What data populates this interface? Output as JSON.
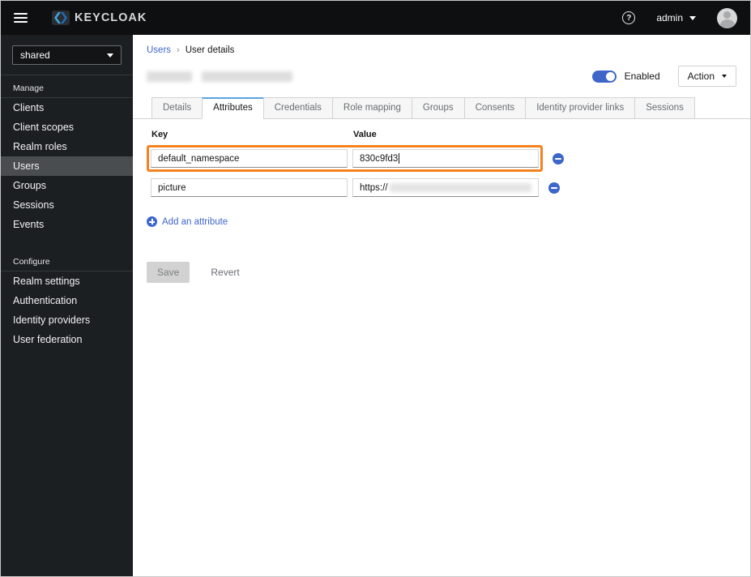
{
  "header": {
    "brand": "KEYCLOAK",
    "help_glyph": "?",
    "username": "admin"
  },
  "sidebar": {
    "realm": "shared",
    "sections": [
      {
        "label": "Manage",
        "items": [
          "Clients",
          "Client scopes",
          "Realm roles",
          "Users",
          "Groups",
          "Sessions",
          "Events"
        ]
      },
      {
        "label": "Configure",
        "items": [
          "Realm settings",
          "Authentication",
          "Identity providers",
          "User federation"
        ]
      }
    ],
    "active_item": "Users"
  },
  "breadcrumb": {
    "parent": "Users",
    "separator": "›",
    "current": "User details"
  },
  "toolbar": {
    "enabled_label": "Enabled",
    "action_label": "Action"
  },
  "tabs": {
    "items": [
      "Details",
      "Attributes",
      "Credentials",
      "Role mapping",
      "Groups",
      "Consents",
      "Identity provider links",
      "Sessions"
    ],
    "active": "Attributes"
  },
  "attributes": {
    "key_header": "Key",
    "value_header": "Value",
    "rows": [
      {
        "key": "default_namespace",
        "value": "830c9fd3",
        "highlighted": true,
        "redacted": false
      },
      {
        "key": "picture",
        "value": "https://",
        "highlighted": false,
        "redacted": true
      }
    ],
    "add_label": "Add an attribute",
    "save_label": "Save",
    "revert_label": "Revert"
  },
  "colors": {
    "highlight_orange": "#F5821F",
    "primary_blue": "#3E66C9",
    "tab_indicator": "#5BA3E0",
    "header_bg": "#0D0F11",
    "sidebar_bg": "#1C1F22"
  }
}
